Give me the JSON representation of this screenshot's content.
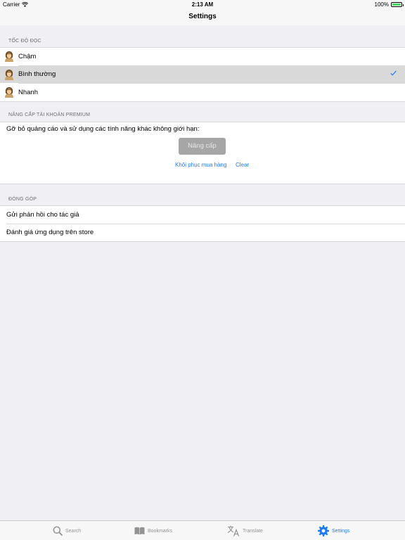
{
  "status_bar": {
    "carrier": "Carrier",
    "time": "2:13 AM",
    "battery": "100%"
  },
  "nav": {
    "title": "Settings"
  },
  "reading_speed": {
    "header": "TỐC ĐỘ ĐỌC",
    "items": [
      {
        "label": "Chậm",
        "selected": false
      },
      {
        "label": "Bình thường",
        "selected": true
      },
      {
        "label": "Nhanh",
        "selected": false
      }
    ]
  },
  "premium": {
    "header": "NÂNG CẤP TÀI KHOẢN PREMIUM",
    "description": "Gỡ bỏ quảng cáo và sử dụng các tính năng khác không giới hạn:",
    "upgrade_label": "Nâng cấp",
    "restore_label": "Khôi phục mua hàng",
    "clear_label": "Clear"
  },
  "contribute": {
    "header": "ĐÓNG GÓP",
    "items": [
      {
        "label": "Gửi phản hồi cho tác giả"
      },
      {
        "label": "Đánh giá ứng dụng trên store"
      }
    ]
  },
  "tabs": [
    {
      "label": "Search",
      "icon": "search-icon",
      "active": false
    },
    {
      "label": "Bookmarks",
      "icon": "book-icon",
      "active": false
    },
    {
      "label": "Translate",
      "icon": "translate-icon",
      "active": false
    },
    {
      "label": "Settings",
      "icon": "gear-icon",
      "active": true
    }
  ],
  "colors": {
    "accent": "#1d7cf2",
    "selected_row": "#d9d9d9",
    "button_disabled": "#a6a6a6"
  }
}
